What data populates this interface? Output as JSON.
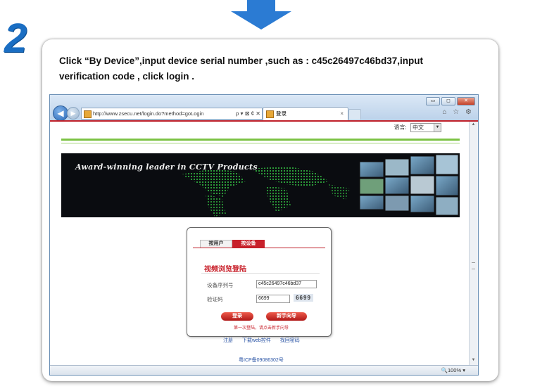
{
  "step": {
    "number": "2"
  },
  "instruction": {
    "line1": "Click “By Device”,input device serial number ,such as : c45c26497c46bd37,input",
    "line2": "verification code , click login ."
  },
  "browser": {
    "url": "http://www.zsecu.net/login.do?method=goLogin",
    "url_tools": "ρ ▾ ⊠ ¢ ✕",
    "tab_title": "登录",
    "tab_close": "×",
    "window_buttons": [
      "▭",
      "◻",
      "✕"
    ],
    "right_tools": "⌂ ☆ ⚙",
    "status_zoom": "🔍100%  ▾"
  },
  "page": {
    "language_label": "语言:",
    "language_value": "中文",
    "banner_slogan": "Award-winning leader in CCTV Products",
    "tabs": {
      "by_user": "按用户",
      "by_device": "按设备"
    },
    "login_title": "视频浏览登陆",
    "serial_label": "设备序列号",
    "serial_value": "c45c26497c46bd37",
    "code_label": "验证码",
    "code_value": "6699",
    "captcha_text": "6699",
    "login_button": "登录",
    "guide_button": "新手向导",
    "hint": "第一次登陆，请点击新手向导",
    "links": [
      "注册",
      "下载web控件",
      "找回密码"
    ],
    "icp": "粤ICP备09086302号"
  },
  "colors": {
    "step_blue": "#1a6ec3",
    "accent_red": "#c8202a",
    "green_rule": "#7cc243",
    "link_blue": "#2a54a5"
  }
}
